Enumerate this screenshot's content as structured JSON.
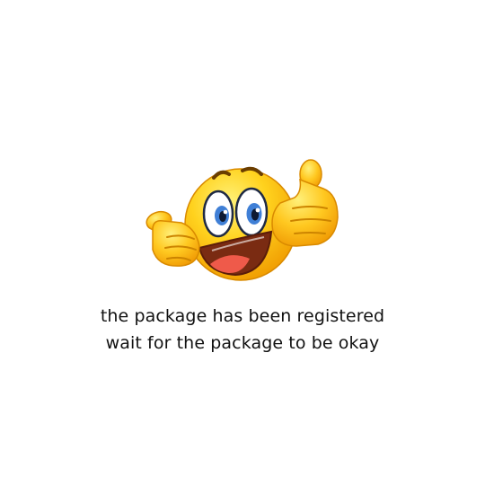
{
  "message": {
    "line1": "the package has been registered",
    "line2": "wait for the package to be okay"
  },
  "illustration": {
    "icon": "thumbs-up-smiley-icon"
  },
  "colors": {
    "background": "#ffffff",
    "text": "#111111",
    "face_light": "#FFE24A",
    "face_dark": "#F2A500",
    "outline": "#8a5a00",
    "iris": "#3f7fd6",
    "mouth": "#7a2b12",
    "tongue": "#ef5a4a"
  }
}
